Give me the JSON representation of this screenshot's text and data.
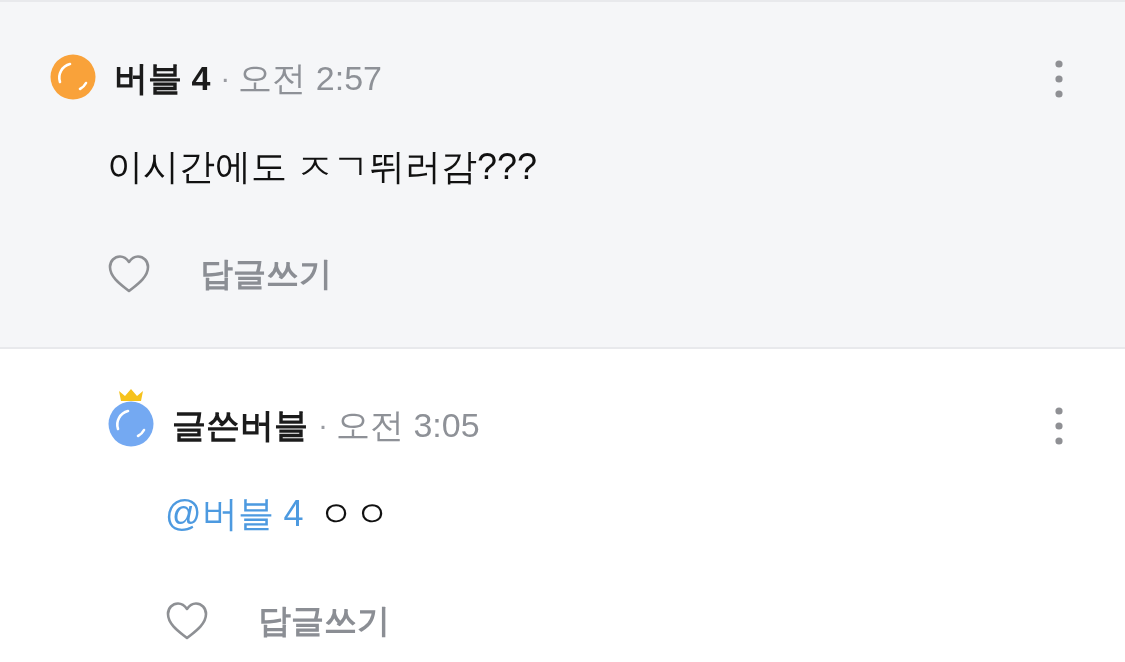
{
  "comments": [
    {
      "kind": "comment",
      "color": "#f9a23a",
      "crown": false,
      "author": "버블 4",
      "separator": "·",
      "time": "오전 2:57",
      "text": "이시간에도 ㅈㄱ뛰러감???",
      "liked": false,
      "reply_label": "답글쓰기"
    },
    {
      "kind": "reply",
      "color": "#74a9f2",
      "crown": true,
      "author": "글쓴버블",
      "separator": "·",
      "time": "오전 3:05",
      "mention": "@버블 4",
      "text": "ㅇㅇ",
      "liked": false,
      "reply_label": "답글쓰기"
    }
  ]
}
